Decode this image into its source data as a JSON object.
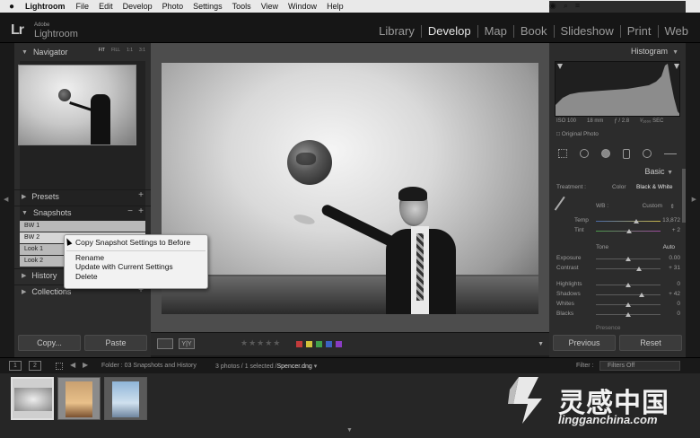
{
  "menubar": {
    "app": "Lightroom",
    "menus": [
      "File",
      "Edit",
      "Develop",
      "Photo",
      "Settings",
      "Tools",
      "View",
      "Window",
      "Help"
    ]
  },
  "header": {
    "logo_mark": "Lr",
    "logo_adobe": "Adobe",
    "logo_name": "Lightroom",
    "modules": [
      "Library",
      "Develop",
      "Map",
      "Book",
      "Slideshow",
      "Print",
      "Web"
    ],
    "active_module": "Develop"
  },
  "left_panel": {
    "navigator": {
      "title": "Navigator",
      "options": [
        "FIT",
        "FILL",
        "1:1",
        "3:1"
      ],
      "selected_option": "FIT"
    },
    "presets": {
      "title": "Presets"
    },
    "snapshots": {
      "title": "Snapshots",
      "items": [
        "BW 1",
        "BW 2",
        "Look 1",
        "Look 2"
      ],
      "selected": "BW 2"
    },
    "history": {
      "title": "History"
    },
    "collections": {
      "title": "Collections"
    },
    "copy_label": "Copy...",
    "paste_label": "Paste"
  },
  "context_menu": {
    "items": [
      "Copy Snapshot Settings to Before",
      "Rename",
      "Update with Current Settings",
      "Delete"
    ]
  },
  "toolbar": {
    "compare_label": "Y|Y",
    "stars": "★★★★★",
    "color_labels": [
      "#c23b3b",
      "#d1c23a",
      "#3fa04a",
      "#3b62c2",
      "#8a3bc2"
    ]
  },
  "right_panel": {
    "histogram": {
      "title": "Histogram",
      "iso": "ISO 100",
      "focal": "18 mm",
      "aperture": "ƒ / 2.8",
      "shutter": "¹⁄₁₆₀₀ SEC",
      "original_label": "Original Photo"
    },
    "basic": {
      "title": "Basic",
      "treatment_label": "Treatment :",
      "treatment_options": [
        "Color",
        "Black & White"
      ],
      "treatment_selected": "Black & White",
      "wb_label": "WB :",
      "wb_value": "Custom",
      "temp": {
        "label": "Temp",
        "value": "13,872",
        "level": 0.62
      },
      "tint": {
        "label": "Tint",
        "value": "+ 2",
        "level": 0.51
      },
      "tone_label": "Tone",
      "auto_label": "Auto",
      "exposure": {
        "label": "Exposure",
        "value": "0.00",
        "level": 0.5
      },
      "contrast": {
        "label": "Contrast",
        "value": "+ 31",
        "level": 0.66
      },
      "highlights": {
        "label": "Highlights",
        "value": "0",
        "level": 0.5
      },
      "shadows": {
        "label": "Shadows",
        "value": "+ 42",
        "level": 0.71
      },
      "whites": {
        "label": "Whites",
        "value": "0",
        "level": 0.5
      },
      "blacks": {
        "label": "Blacks",
        "value": "0",
        "level": 0.5
      },
      "presence_label": "Presence"
    },
    "previous_label": "Previous",
    "reset_label": "Reset"
  },
  "filmstrip_bar": {
    "page1": "1",
    "page2": "2",
    "folder": "Folder : 03 Snapshots and History",
    "count": "3 photos / 1 selected /",
    "filename": "Spencer.dng",
    "filter_label": "Filter :",
    "filter_value": "Filters Off"
  },
  "watermark": {
    "cn": "灵感中国",
    "en": "lingganchina.com"
  }
}
